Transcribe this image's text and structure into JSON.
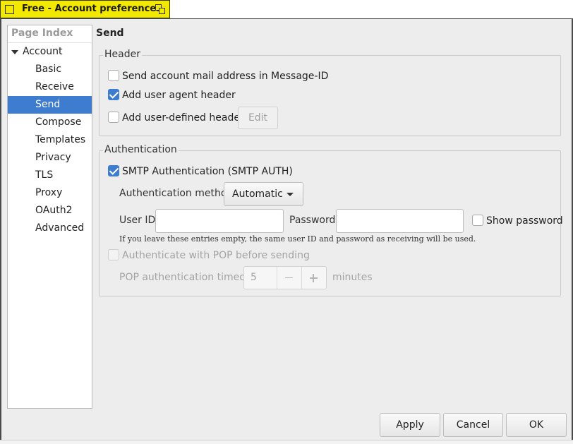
{
  "window": {
    "title": "Free - Account preferences"
  },
  "page_index": {
    "header": "Page Index",
    "items": [
      {
        "label": "Account",
        "level": 0,
        "expanded": true
      },
      {
        "label": "Basic",
        "level": 1
      },
      {
        "label": "Receive",
        "level": 1
      },
      {
        "label": "Send",
        "level": 1,
        "selected": true
      },
      {
        "label": "Compose",
        "level": 1
      },
      {
        "label": "Templates",
        "level": 1
      },
      {
        "label": "Privacy",
        "level": 1
      },
      {
        "label": "TLS",
        "level": 1
      },
      {
        "label": "Proxy",
        "level": 1
      },
      {
        "label": "OAuth2",
        "level": 1
      },
      {
        "label": "Advanced",
        "level": 1
      }
    ]
  },
  "page": {
    "title": "Send",
    "header_group": {
      "legend": "Header",
      "msgid_label": "Send account mail address in Message-ID",
      "msgid_checked": false,
      "useragent_label": "Add user agent header",
      "useragent_checked": true,
      "userdefined_label": "Add user-defined header",
      "userdefined_checked": false,
      "edit_button": "Edit"
    },
    "auth_group": {
      "legend": "Authentication",
      "smtp_auth_label": "SMTP Authentication (SMTP AUTH)",
      "smtp_auth_checked": true,
      "method_label": "Authentication method",
      "method_value": "Automatic",
      "userid_label": "User ID",
      "userid_value": "",
      "password_label": "Password",
      "password_value": "",
      "show_password_label": "Show password",
      "show_password_checked": false,
      "hint": "If you leave these entries empty, the same user ID and password as receiving will be used.",
      "pop_before_label": "Authenticate with POP before sending",
      "pop_before_checked": false,
      "pop_timeout_label": "POP authentication timeout",
      "pop_timeout_value": "5",
      "pop_timeout_unit": "minutes"
    }
  },
  "buttons": {
    "apply": "Apply",
    "cancel": "Cancel",
    "ok": "OK"
  },
  "colors": {
    "titlebar": "#f2e800",
    "selection": "#3d7ccf",
    "dialog_bg": "#ededed"
  }
}
